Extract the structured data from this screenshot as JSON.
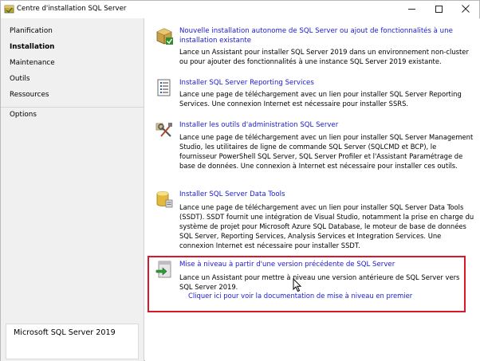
{
  "window": {
    "title": "Centre d'installation SQL Server",
    "controls": {
      "minimize": "minimize-icon",
      "maximize": "maximize-icon",
      "close": "close-icon"
    }
  },
  "sidebar": {
    "items": [
      {
        "label": "Planification",
        "active": false
      },
      {
        "label": "Installation",
        "active": true
      },
      {
        "label": "Maintenance",
        "active": false
      },
      {
        "label": "Outils",
        "active": false
      },
      {
        "label": "Ressources",
        "active": false
      },
      {
        "label": "Options",
        "active": false
      }
    ],
    "brand": "Microsoft SQL Server 2019"
  },
  "main": {
    "entries": [
      {
        "icon": "box-install-icon",
        "title": "Nouvelle installation autonome de SQL Server ou ajout de fonctionnalités à une installation existante",
        "description": "Lance un Assistant pour installer SQL Server 2019 dans un environnement non-cluster ou pour ajouter des fonctionnalités à une instance SQL Server 2019 existante."
      },
      {
        "icon": "report-icon",
        "title": "Installer SQL Server Reporting Services",
        "description": "Lance une page de téléchargement avec un lien pour installer SQL Server Reporting Services. Une connexion Internet est nécessaire pour installer SSRS."
      },
      {
        "icon": "tools-icon",
        "title": "Installer les outils d'administration SQL Server",
        "description": "Lance une page de téléchargement avec un lien pour installer SQL Server Management Studio, les utilitaires de ligne de commande SQL Server (SQLCMD et BCP), le fournisseur PowerShell SQL Server, SQL Server Profiler et l'Assistant Paramétrage de base de données. Une connexion à Internet est nécessaire pour installer ces outils."
      },
      {
        "icon": "database-icon",
        "title": "Installer SQL Server Data Tools",
        "description": "Lance une page de téléchargement avec un lien pour installer SQL Server Data Tools (SSDT). SSDT fournit une intégration de Visual Studio, notamment la prise en charge du système de projet pour Microsoft Azure SQL Database, le moteur de base de données SQL Server, Reporting Services, Analysis Services et Integration Services. Une connexion Internet est nécessaire pour installer SSDT."
      },
      {
        "icon": "upgrade-icon",
        "title": "Mise à niveau à partir d'une version précédente de SQL Server",
        "description": "Lance un Assistant pour mettre à niveau une version antérieure de SQL Server vers SQL Server 2019.",
        "link": "Cliquer ici pour voir la documentation de mise à niveau en premier",
        "highlighted": true
      }
    ]
  },
  "colors": {
    "link": "#1a1ad2",
    "highlight": "#d9192b",
    "sidebar_bg": "#f0f0f0"
  }
}
